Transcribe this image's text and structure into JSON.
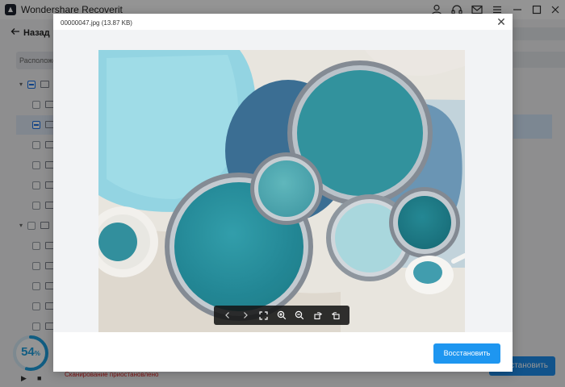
{
  "app": {
    "title": "Wondershare Recoverit",
    "window_controls": [
      "user-icon",
      "headset-icon",
      "mail-icon",
      "menu-icon",
      "minimize-icon",
      "maximize-icon",
      "close-icon"
    ]
  },
  "nav": {
    "back_label": "Назад"
  },
  "location": {
    "label": "Расположе"
  },
  "scan": {
    "progress_percent": "54",
    "progress_unit": "%",
    "status_text": "Сканирование приостановлено",
    "recover_label": "Восстановить"
  },
  "preview": {
    "file_title": "00000047.jpg (13.87 KB)",
    "close_icon": "close-icon",
    "recover_label": "Восстановить",
    "toolbar": [
      "prev-icon",
      "next-icon",
      "fullscreen-icon",
      "zoom-in-icon",
      "zoom-out-icon",
      "rotate-right-icon",
      "rotate-left-icon"
    ],
    "accent": "#1e96f0"
  }
}
